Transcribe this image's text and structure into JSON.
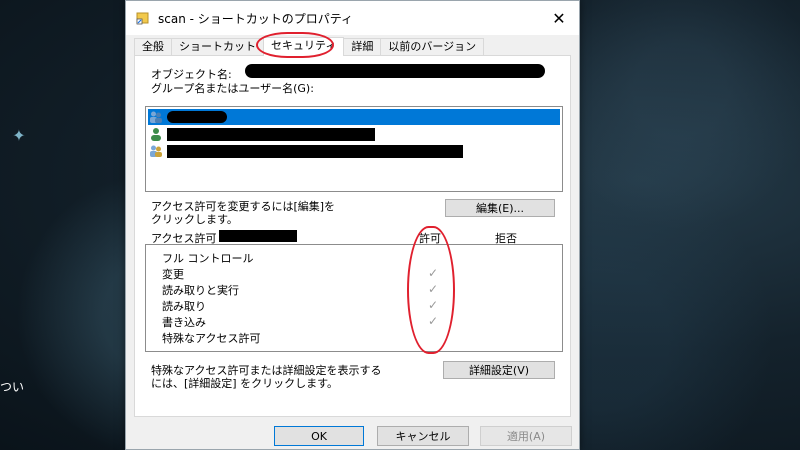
{
  "desktop": {
    "fragment_text": "つい"
  },
  "window": {
    "title": "scan - ショートカットのプロパティ",
    "close_glyph": "✕"
  },
  "tabs": [
    {
      "label": "全般"
    },
    {
      "label": "ショートカット"
    },
    {
      "label": "セキュリティ"
    },
    {
      "label": "詳細"
    },
    {
      "label": "以前のバージョン"
    }
  ],
  "security": {
    "object_name_label": "オブジェクト名:",
    "group_user_label": "グループ名またはユーザー名(G):",
    "change_hint_line1": "アクセス許可を変更するには[編集]を",
    "change_hint_line2": "クリックします。",
    "edit_button": "編集(E)...",
    "permissions_label": "アクセス許可",
    "col_allow": "許可",
    "col_deny": "拒否",
    "permissions": [
      {
        "name": "フル コントロール",
        "allow": false
      },
      {
        "name": "変更",
        "allow": true
      },
      {
        "name": "読み取りと実行",
        "allow": true
      },
      {
        "name": "読み取り",
        "allow": true
      },
      {
        "name": "書き込み",
        "allow": true
      },
      {
        "name": "特殊なアクセス許可",
        "allow": false
      }
    ],
    "special_hint_line1": "特殊なアクセス許可または詳細設定を表示する",
    "special_hint_line2": "には、[詳細設定] をクリックします。",
    "advanced_button": "詳細設定(V)",
    "check_glyph": "✓"
  },
  "footer": {
    "ok": "OK",
    "cancel": "キャンセル",
    "apply": "適用(A)"
  },
  "colors": {
    "selection": "#0078d7",
    "annotation": "#e0202e"
  }
}
